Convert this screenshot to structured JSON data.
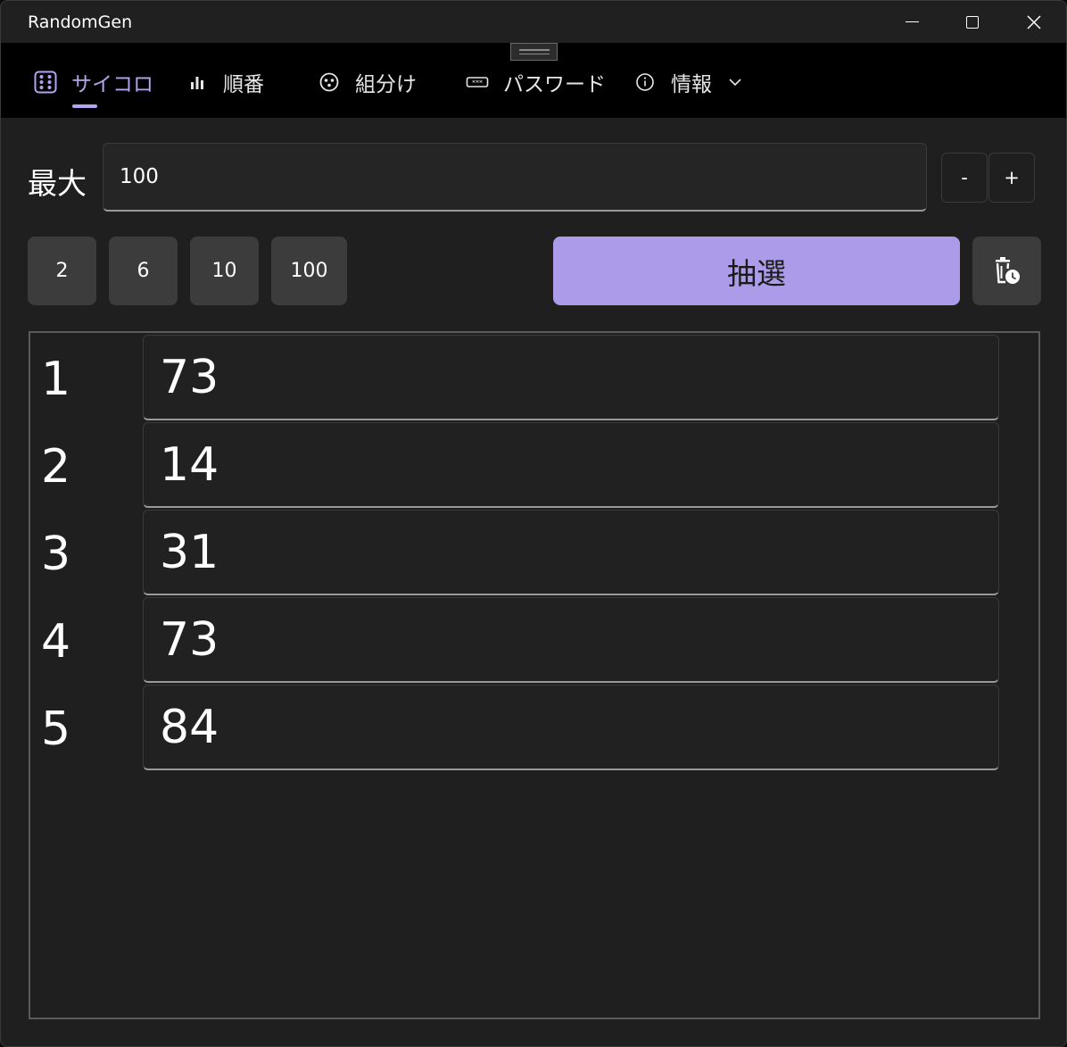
{
  "window": {
    "title": "RandomGen"
  },
  "nav": {
    "items": [
      {
        "label": "サイコロ",
        "icon": "dice-icon",
        "active": true
      },
      {
        "label": "順番",
        "icon": "bar-chart-icon",
        "active": false
      },
      {
        "label": "組分け",
        "icon": "group-icon",
        "active": false
      },
      {
        "label": "パスワード",
        "icon": "password-icon",
        "active": false
      },
      {
        "label": "情報",
        "icon": "info-icon",
        "active": false
      }
    ]
  },
  "settings": {
    "max_label": "最大",
    "max_value": "100",
    "decrement_label": "-",
    "increment_label": "+"
  },
  "presets": [
    "2",
    "6",
    "10",
    "100"
  ],
  "actions": {
    "draw_label": "抽選",
    "clear_icon": "delete-history-icon"
  },
  "results": [
    {
      "index": "1",
      "value": "73"
    },
    {
      "index": "2",
      "value": "14"
    },
    {
      "index": "3",
      "value": "31"
    },
    {
      "index": "4",
      "value": "73"
    },
    {
      "index": "5",
      "value": "84"
    }
  ],
  "colors": {
    "accent": "#ac9be8",
    "active_nav": "#b4a4f0",
    "background": "#1f1f1f"
  }
}
